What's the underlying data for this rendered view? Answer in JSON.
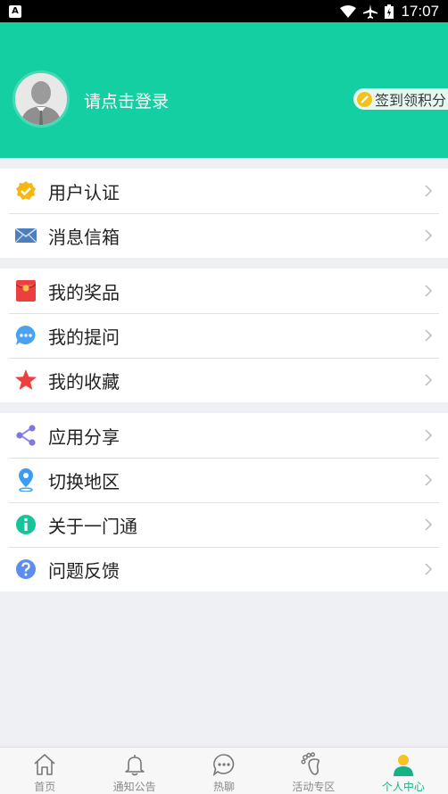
{
  "status_bar": {
    "time": "17:07",
    "notif_letter": "A"
  },
  "header": {
    "login_text": "请点击登录",
    "signin_label": "签到领积分"
  },
  "groups": [
    {
      "items": [
        {
          "label": "用户认证",
          "icon": "verified-badge-icon"
        },
        {
          "label": "消息信箱",
          "icon": "envelope-icon"
        }
      ]
    },
    {
      "items": [
        {
          "label": "我的奖品",
          "icon": "red-packet-icon"
        },
        {
          "label": "我的提问",
          "icon": "chat-bubble-icon"
        },
        {
          "label": "我的收藏",
          "icon": "star-icon"
        }
      ]
    },
    {
      "items": [
        {
          "label": "应用分享",
          "icon": "share-icon"
        },
        {
          "label": "切换地区",
          "icon": "location-pin-icon"
        },
        {
          "label": "关于一门通",
          "icon": "info-icon"
        },
        {
          "label": "问题反馈",
          "icon": "question-icon"
        }
      ]
    }
  ],
  "tabs": [
    {
      "label": "首页",
      "icon": "home-icon"
    },
    {
      "label": "通知公告",
      "icon": "bell-icon"
    },
    {
      "label": "热聊",
      "icon": "chat-icon"
    },
    {
      "label": "活动专区",
      "icon": "footprint-icon"
    },
    {
      "label": "个人中心",
      "icon": "person-icon",
      "active": true
    }
  ],
  "colors": {
    "accent": "#14cfa1",
    "active_tab": "#14b386"
  }
}
